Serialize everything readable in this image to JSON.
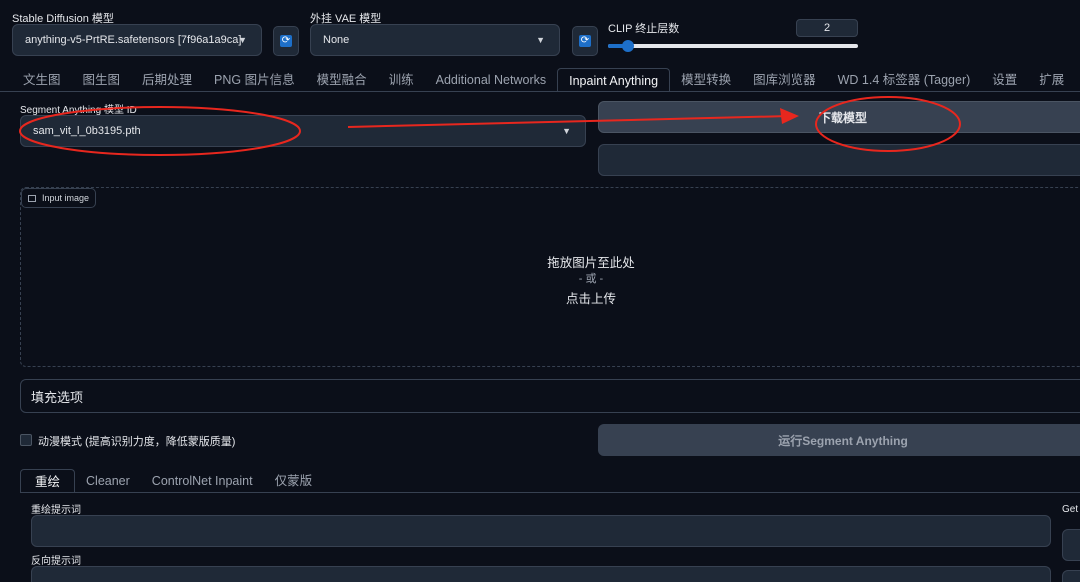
{
  "top": {
    "sd_model_label": "Stable Diffusion 模型",
    "sd_model_value": "anything-v5-PrtRE.safetensors [7f96a1a9ca]",
    "vae_label": "外挂 VAE 模型",
    "vae_value": "None",
    "clip_label": "CLIP 终止层数",
    "clip_value": "2",
    "clip_slider_fraction": 0.08
  },
  "tabs": [
    {
      "label": "文生图"
    },
    {
      "label": "图生图"
    },
    {
      "label": "后期处理"
    },
    {
      "label": "PNG 图片信息"
    },
    {
      "label": "模型融合"
    },
    {
      "label": "训练"
    },
    {
      "label": "Additional Networks"
    },
    {
      "label": "Inpaint Anything"
    },
    {
      "label": "模型转换"
    },
    {
      "label": "图库浏览器"
    },
    {
      "label": "WD 1.4 标签器 (Tagger)"
    },
    {
      "label": "设置"
    },
    {
      "label": "扩展"
    }
  ],
  "inpaint": {
    "sam_label": "Segment Anything 模型 ID",
    "sam_value": "sam_vit_l_0b3195.pth",
    "download_button": "下载模型",
    "input_image_label": "Input image",
    "drop_line1": "拖放图片至此处",
    "drop_line2": "- 或 -",
    "drop_line3": "点击上传",
    "fill_options": "填充选项",
    "anime_mode": "动漫模式 (提高识别力度，降低蒙版质量)",
    "run_button": "运行Segment Anything",
    "subtabs": [
      {
        "label": "重绘"
      },
      {
        "label": "Cleaner"
      },
      {
        "label": "ControlNet Inpaint"
      },
      {
        "label": "仅蒙版"
      }
    ],
    "prompt_label": "重绘提示词",
    "neg_prompt_label": "反向提示词",
    "get_label": "Get"
  },
  "colors": {
    "background": "#0b0f19",
    "accent": "#1d6fc9",
    "annotation_red": "#e8271e"
  }
}
